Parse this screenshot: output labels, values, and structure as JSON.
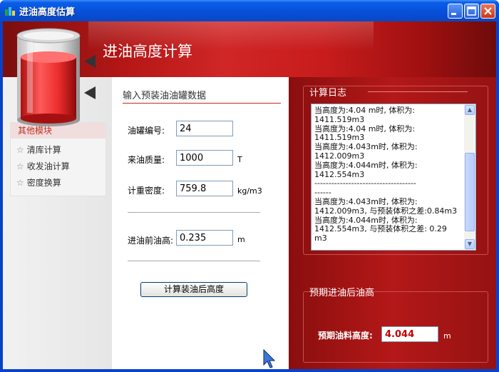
{
  "window": {
    "title": "进油高度估算",
    "header_title": "进油高度计算"
  },
  "sidebar": {
    "heading": "其他模块",
    "items": [
      {
        "label": "清库计算",
        "icon": "star-icon"
      },
      {
        "label": "收发油计算",
        "icon": "star-icon"
      },
      {
        "label": "密度换算",
        "icon": "star-icon"
      }
    ]
  },
  "form": {
    "section_title": "输入预装油油罐数据",
    "tank_number": {
      "label": "油罐编号:",
      "value": "24"
    },
    "oil_mass": {
      "label": "来油质量:",
      "value": "1000",
      "unit": "T"
    },
    "density": {
      "label": "计重密度:",
      "value": "759.8",
      "unit": "kg/m3"
    },
    "initial_height": {
      "label": "进油前油高:",
      "value": "0.235",
      "unit": "m"
    },
    "calculate_button": "计算装油后高度"
  },
  "log": {
    "title": "计算日志",
    "content": "当高度为:4.04 m时, 体积为:\n1411.519m3\n当高度为:4.04 m时, 体积为:\n1411.519m3\n当高度为:4.043m时, 体积为:\n1412.009m3\n当高度为:4.044m时, 体积为:\n1412.554m3\n------------------------------------\n------\n当高度为:4.043m时, 体积为:\n1412.009m3, 与预装体积之差:0.84m3\n当高度为:4.044m时, 体积为:\n1412.554m3, 与预装体积之差: 0.29 m3"
  },
  "prediction": {
    "title": "预期进油后油高",
    "label": "预期油料高度:",
    "value": "4.044",
    "unit": "m"
  }
}
